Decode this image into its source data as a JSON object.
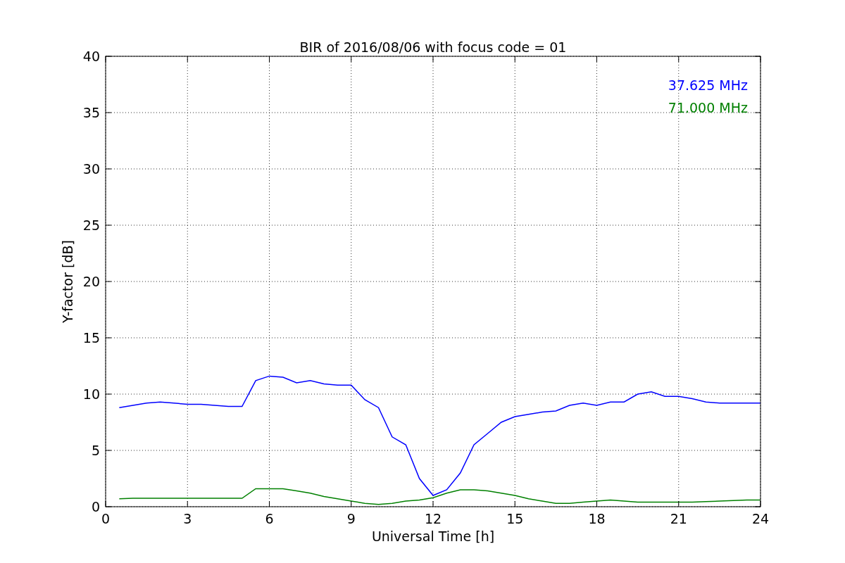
{
  "chart_data": {
    "type": "line",
    "title": "BIR of 2016/08/06 with focus code = 01",
    "xlabel": "Universal Time [h]",
    "ylabel": "Y-factor [dB]",
    "x": [
      0.5,
      1,
      1.5,
      2,
      2.5,
      3,
      3.5,
      4,
      4.5,
      5,
      5.5,
      6,
      6.5,
      7,
      7.5,
      8,
      8.5,
      9,
      9.5,
      10,
      10.5,
      11,
      11.5,
      12,
      12.5,
      13,
      13.5,
      14,
      14.5,
      15,
      15.5,
      16,
      16.5,
      17,
      17.5,
      18,
      18.5,
      19,
      19.5,
      20,
      20.5,
      21,
      21.5,
      22,
      22.5,
      23,
      23.5,
      24
    ],
    "series": [
      {
        "name": "37.625 MHz",
        "color": "#0000ff",
        "values": [
          8.8,
          9.0,
          9.2,
          9.3,
          9.2,
          9.1,
          9.1,
          9.0,
          8.9,
          8.9,
          11.2,
          11.6,
          11.5,
          11.0,
          11.2,
          10.9,
          10.8,
          10.8,
          9.5,
          8.8,
          6.2,
          5.5,
          2.5,
          1.0,
          1.5,
          3.0,
          5.5,
          6.5,
          7.5,
          8.0,
          8.2,
          8.4,
          8.5,
          9.0,
          9.2,
          9.0,
          9.3,
          9.3,
          10.0,
          10.2,
          9.8,
          9.8,
          9.6,
          9.3,
          9.2,
          9.2,
          9.2,
          9.2
        ]
      },
      {
        "name": "71.000 MHz",
        "color": "#008000",
        "values": [
          0.7,
          0.75,
          0.75,
          0.75,
          0.75,
          0.75,
          0.75,
          0.75,
          0.75,
          0.75,
          1.6,
          1.6,
          1.6,
          1.4,
          1.2,
          0.9,
          0.7,
          0.5,
          0.3,
          0.2,
          0.3,
          0.5,
          0.6,
          0.8,
          1.2,
          1.5,
          1.5,
          1.4,
          1.2,
          1.0,
          0.7,
          0.5,
          0.3,
          0.3,
          0.4,
          0.5,
          0.6,
          0.5,
          0.4,
          0.4,
          0.4,
          0.4,
          0.4,
          0.45,
          0.5,
          0.55,
          0.6,
          0.6
        ]
      }
    ],
    "grid": true,
    "xlim": [
      0,
      24
    ],
    "ylim": [
      0,
      40
    ],
    "xticks": [
      0,
      3,
      6,
      9,
      12,
      15,
      18,
      21,
      24
    ],
    "yticks": [
      0,
      5,
      10,
      15,
      20,
      25,
      30,
      35,
      40
    ]
  }
}
